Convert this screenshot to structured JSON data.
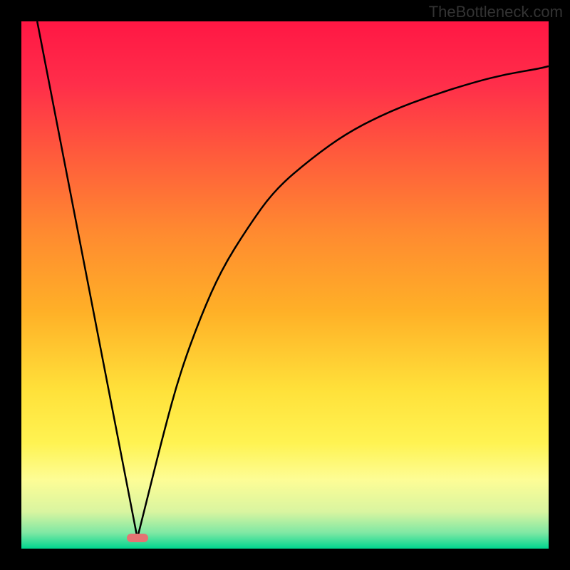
{
  "watermark": "TheBottleneck.com",
  "chart_data": {
    "type": "line",
    "title": "",
    "xlabel": "",
    "ylabel": "",
    "xlim": [
      0,
      100
    ],
    "ylim": [
      0,
      100
    ],
    "gradient_stops": [
      {
        "offset": 0.0,
        "color": "#ff1744"
      },
      {
        "offset": 0.12,
        "color": "#ff2e4a"
      },
      {
        "offset": 0.25,
        "color": "#ff5a3c"
      },
      {
        "offset": 0.4,
        "color": "#ff8a30"
      },
      {
        "offset": 0.55,
        "color": "#ffb027"
      },
      {
        "offset": 0.7,
        "color": "#ffe13a"
      },
      {
        "offset": 0.8,
        "color": "#fff352"
      },
      {
        "offset": 0.87,
        "color": "#fdfd96"
      },
      {
        "offset": 0.93,
        "color": "#d9f5a0"
      },
      {
        "offset": 0.97,
        "color": "#7fe8a4"
      },
      {
        "offset": 1.0,
        "color": "#00d68f"
      }
    ],
    "series": [
      {
        "name": "left-v",
        "x": [
          3,
          22
        ],
        "y": [
          100,
          2
        ]
      },
      {
        "name": "right-curve",
        "x": [
          22,
          24,
          27,
          30,
          34,
          38,
          43,
          48,
          55,
          62,
          70,
          78,
          86,
          92,
          98,
          100
        ],
        "y": [
          2,
          10,
          22,
          33,
          44,
          53,
          61,
          68,
          74,
          79,
          83,
          86,
          88.5,
          90,
          91,
          91.5
        ]
      }
    ],
    "marker": {
      "x": 22,
      "y": 2,
      "color": "#e57373"
    }
  }
}
